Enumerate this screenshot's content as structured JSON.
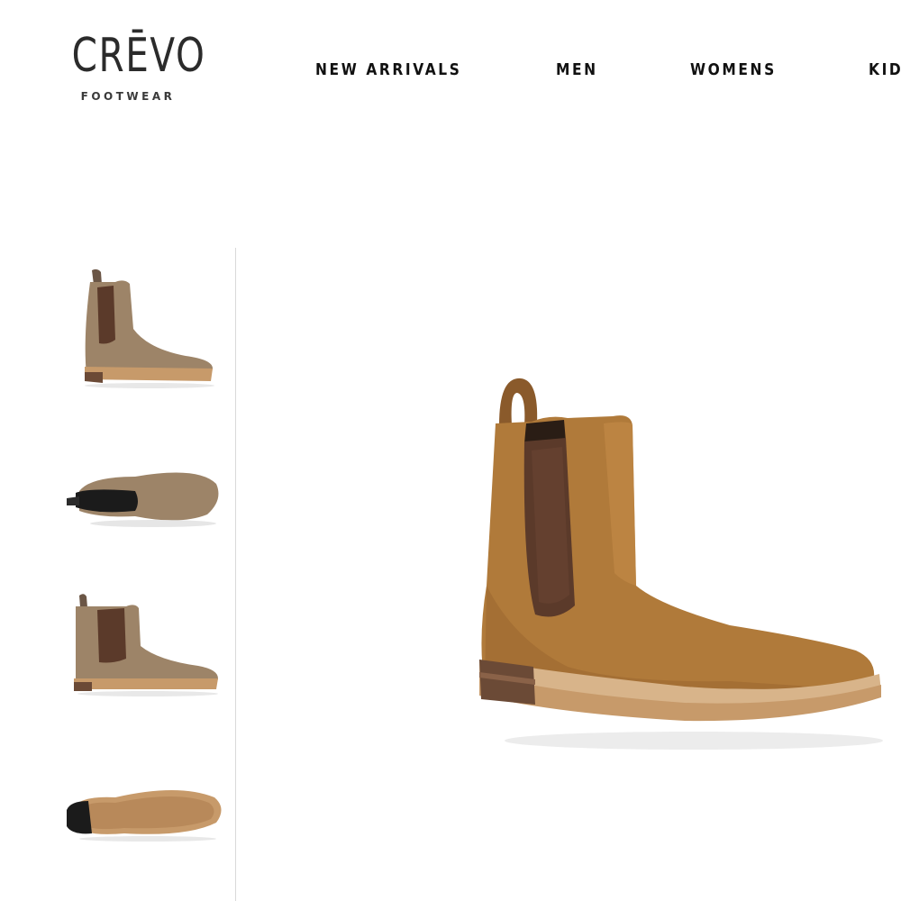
{
  "brand": {
    "name": "CRĒVO",
    "tagline": "FOOTWEAR"
  },
  "nav": {
    "items": [
      {
        "label": "NEW ARRIVALS"
      },
      {
        "label": "MEN"
      },
      {
        "label": "WOMENS"
      },
      {
        "label": "KID"
      }
    ]
  },
  "gallery": {
    "thumbnails": [
      {
        "view": "side-profile",
        "icon": "boot-side-thumbnail"
      },
      {
        "view": "top-down",
        "icon": "boot-top-thumbnail"
      },
      {
        "view": "outer-side",
        "icon": "boot-outer-thumbnail"
      },
      {
        "view": "sole",
        "icon": "boot-sole-thumbnail"
      }
    ],
    "main_view": "three-quarter",
    "colors": {
      "suede_main": "#b07a3a",
      "suede_thumb": "#9d8468",
      "elastic": "#5b3a2a",
      "sole": "#c79a6a",
      "heel": "#6b4a36"
    }
  }
}
